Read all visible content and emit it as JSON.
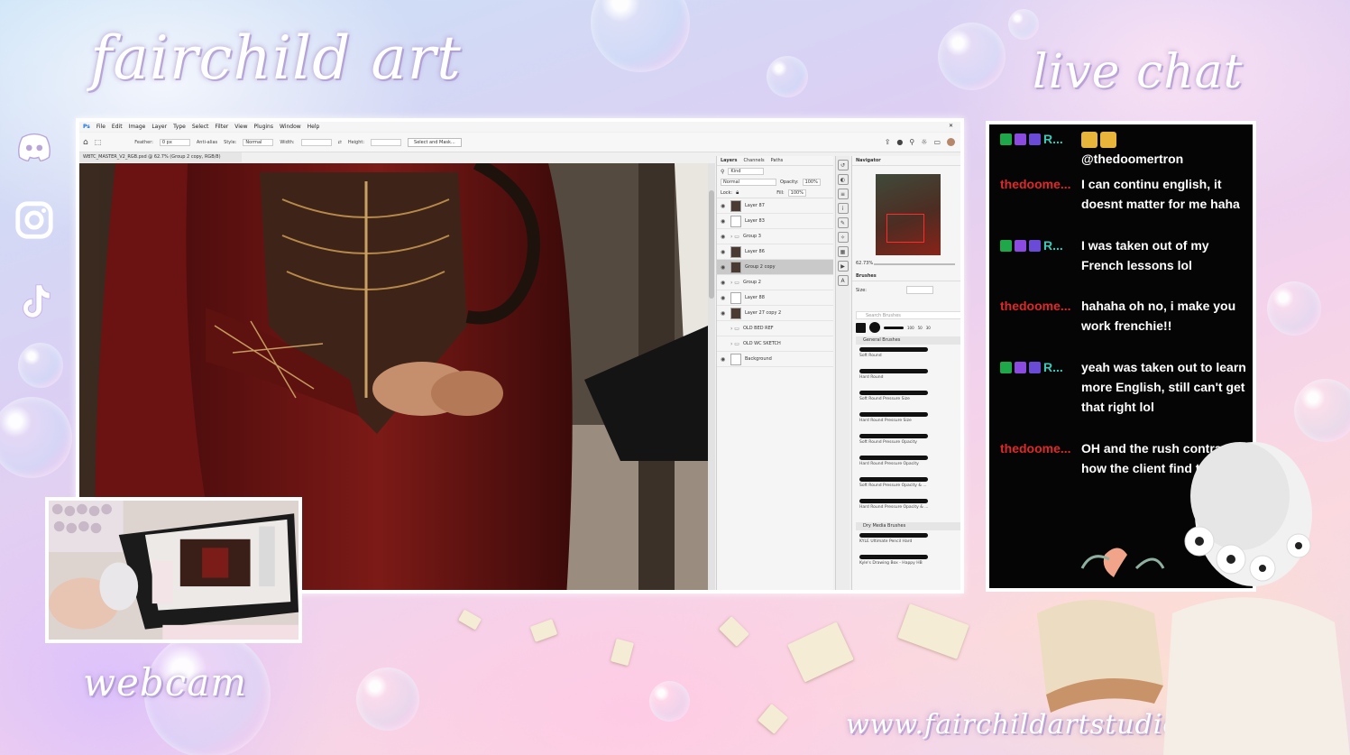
{
  "overlay": {
    "brand_title": "fairchild art",
    "chat_title": "live chat",
    "webcam_title": "webcam",
    "url": "www.fairchildartstudio.com",
    "socials": [
      {
        "name": "discord",
        "icon": "discord-icon",
        "color": "#ffffff"
      },
      {
        "name": "instagram",
        "icon": "instagram-icon",
        "color": "#ffffff"
      },
      {
        "name": "tiktok",
        "icon": "tiktok-icon",
        "color": "#ffffff"
      }
    ]
  },
  "photoshop": {
    "menu": [
      "File",
      "Edit",
      "Image",
      "Layer",
      "Type",
      "Select",
      "Filter",
      "View",
      "Plugins",
      "Window",
      "Help"
    ],
    "options": {
      "feather_label": "Feather:",
      "feather_value": "0 px",
      "anti_alias": "Anti-alias",
      "style_label": "Style:",
      "style_value": "Normal",
      "width_label": "Width:",
      "height_label": "Height:",
      "select_mask_button": "Select and Mask..."
    },
    "doc_tab": "WBTC_MASTER_V2_RGB.psd @ 62.7% (Group 2 copy, RGB/8)",
    "layers_panel": {
      "tabs": [
        "Layers",
        "Channels",
        "Paths"
      ],
      "kind": "Kind",
      "blend_mode": "Normal",
      "opacity_label": "Opacity:",
      "opacity_value": "100%",
      "lock_label": "Lock:",
      "fill_label": "Fill:",
      "fill_value": "100%",
      "layers": [
        {
          "name": "Layer 87",
          "thumb": "dark",
          "eye": true,
          "selected": false,
          "folder": false
        },
        {
          "name": "Layer 83",
          "thumb": "light",
          "eye": true,
          "selected": false,
          "folder": false
        },
        {
          "name": "Group 3",
          "thumb": "none",
          "eye": true,
          "selected": false,
          "folder": true
        },
        {
          "name": "Layer 86",
          "thumb": "dark",
          "eye": true,
          "selected": false,
          "folder": false
        },
        {
          "name": "Group 2 copy",
          "thumb": "dark",
          "eye": true,
          "selected": true,
          "folder": false
        },
        {
          "name": "Group 2",
          "thumb": "none",
          "eye": true,
          "selected": false,
          "folder": true
        },
        {
          "name": "Layer 88",
          "thumb": "light",
          "eye": true,
          "selected": false,
          "folder": false
        },
        {
          "name": "Layer 27 copy 2",
          "thumb": "dark",
          "eye": true,
          "selected": false,
          "folder": false
        },
        {
          "name": "OLD BED REF",
          "thumb": "none",
          "eye": false,
          "selected": false,
          "folder": true
        },
        {
          "name": "OLD WC SKETCH",
          "thumb": "none",
          "eye": false,
          "selected": false,
          "folder": true
        },
        {
          "name": "Background",
          "thumb": "light",
          "eye": true,
          "selected": false,
          "folder": false
        }
      ]
    },
    "navigator": {
      "tab": "Navigator",
      "zoom": "62.73%"
    },
    "brushes": {
      "tab": "Brushes",
      "size_label": "Size:",
      "search_placeholder": "Search Brushes",
      "preset_sizes": [
        "100",
        "50",
        "30"
      ],
      "groups": [
        {
          "name": "General Brushes",
          "items": [
            "Soft Round",
            "Hard Round",
            "Soft Round Pressure Size",
            "Hard Round Pressure Size",
            "Soft Round Pressure Opacity",
            "Hard Round Pressure Opacity",
            "Soft Round Pressure Opacity & ...",
            "Hard Round Pressure Opacity & ..."
          ]
        },
        {
          "name": "Dry Media Brushes",
          "items": [
            "KYLE Ultimate Pencil Hard",
            "Kyle's Drawing Box - Happy HB"
          ]
        }
      ]
    }
  },
  "chat": {
    "messages": [
      {
        "user": "R...",
        "color": "teal",
        "badges": true,
        "text": "@thedoomertron",
        "emoji": true
      },
      {
        "user": "thedoome...",
        "color": "red",
        "badges": false,
        "text": "I can continu english, it doesnt matter for me haha",
        "emoji": false
      },
      {
        "user": "R...",
        "color": "teal",
        "badges": true,
        "text": "I was taken out of my French lessons lol",
        "emoji": false
      },
      {
        "user": "thedoome...",
        "color": "red",
        "badges": false,
        "text": "hahaha oh no, i make you work frenchie!!",
        "emoji": false
      },
      {
        "user": "R...",
        "color": "teal",
        "badges": true,
        "text": "yeah was taken out to learn more English, still can't get that right lol",
        "emoji": false
      },
      {
        "user": "thedoome...",
        "color": "red",
        "badges": false,
        "text": "OH and the rush contract, how the client find the aert?",
        "emoji": false
      }
    ]
  }
}
